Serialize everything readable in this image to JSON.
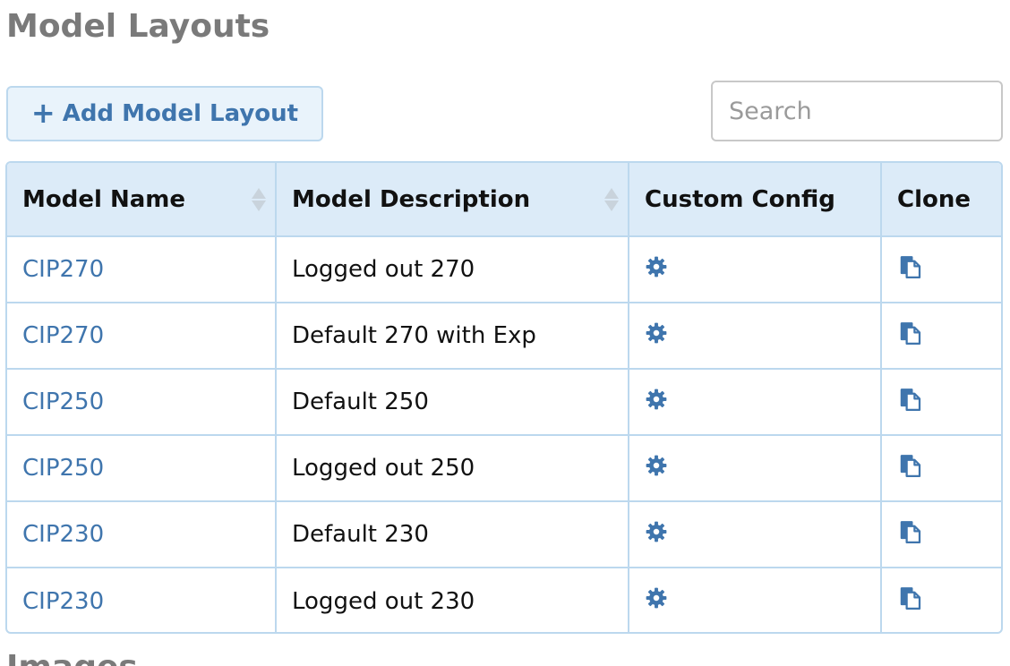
{
  "page": {
    "section_title": "Model Layouts",
    "next_section_title": "Images"
  },
  "toolbar": {
    "add_label": "Add Model Layout",
    "add_icon": "plus-icon",
    "search_placeholder": "Search",
    "search_value": ""
  },
  "table": {
    "headers": {
      "model_name": "Model Name",
      "model_description": "Model Description",
      "custom_config": "Custom Config",
      "clone": "Clone"
    },
    "sortable": [
      "model_name",
      "model_description"
    ],
    "rows": [
      {
        "model_name": "CIP270",
        "model_description": "Logged out 270",
        "config_icon": "gear-icon",
        "clone_icon": "copy-icon"
      },
      {
        "model_name": "CIP270",
        "model_description": "Default 270 with Exp",
        "config_icon": "gear-icon",
        "clone_icon": "copy-icon"
      },
      {
        "model_name": "CIP250",
        "model_description": "Default 250",
        "config_icon": "gear-icon",
        "clone_icon": "copy-icon"
      },
      {
        "model_name": "CIP250",
        "model_description": "Logged out 250",
        "config_icon": "gear-icon",
        "clone_icon": "copy-icon"
      },
      {
        "model_name": "CIP230",
        "model_description": "Default 230",
        "config_icon": "gear-icon",
        "clone_icon": "copy-icon"
      },
      {
        "model_name": "CIP230",
        "model_description": "Logged out 230",
        "config_icon": "gear-icon",
        "clone_icon": "copy-icon"
      }
    ]
  },
  "colors": {
    "link": "#3f75ad",
    "header_bg": "#dcebf8",
    "border": "#bcd8ee",
    "title": "#7a7a7a",
    "button_bg": "#e9f3fb"
  }
}
